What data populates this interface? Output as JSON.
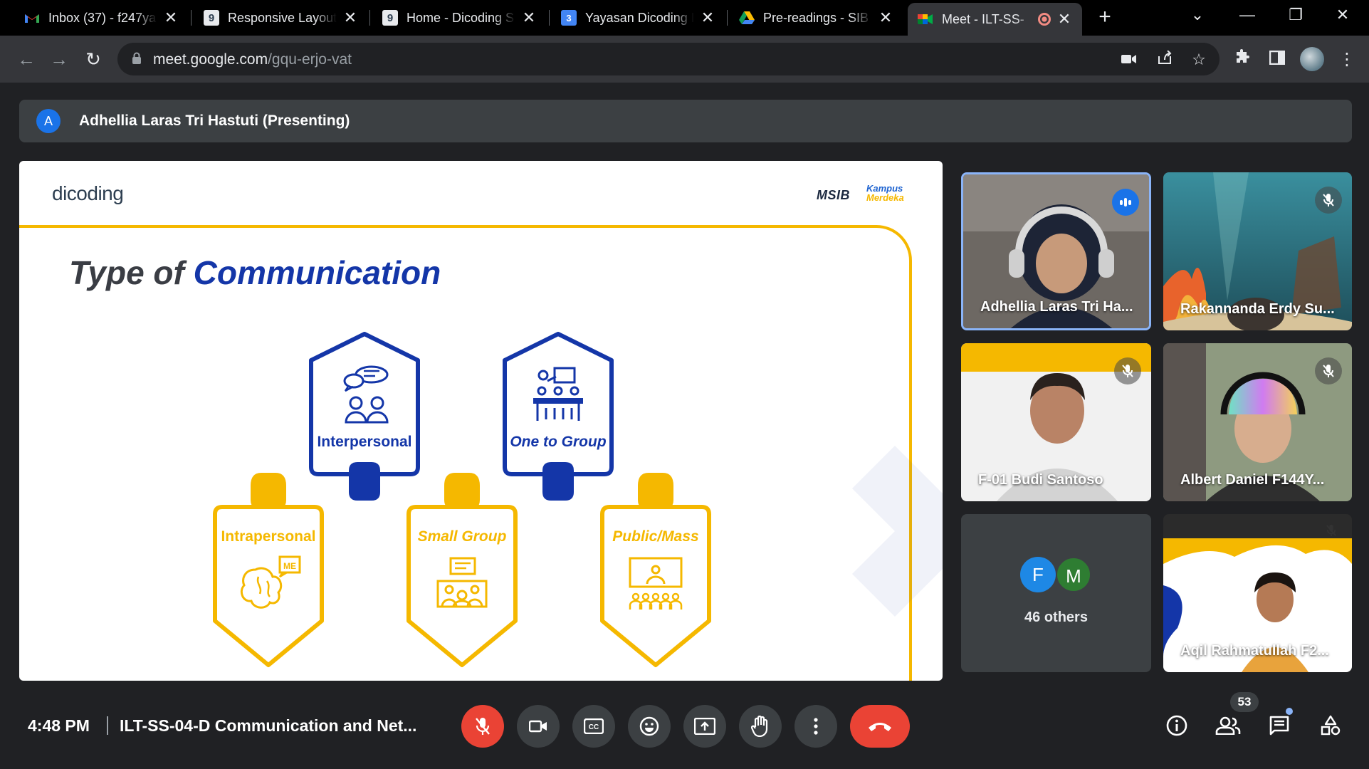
{
  "browser": {
    "tabs": [
      {
        "title": "Inbox (37) - f247ya",
        "icon": "gmail-icon"
      },
      {
        "title": "Responsive Layout",
        "icon": "dicoding-icon"
      },
      {
        "title": "Home - Dicoding S",
        "icon": "dicoding-icon"
      },
      {
        "title": "Yayasan Dicoding I",
        "icon": "calendar-icon"
      },
      {
        "title": "Pre-readings - SIB",
        "icon": "drive-icon"
      },
      {
        "title": "Meet - ILT-SS-",
        "icon": "meet-icon",
        "active": true
      }
    ],
    "calendar_day": "3",
    "url_host": "meet.google.com",
    "url_path": "/gqu-erjo-vat"
  },
  "presenting": {
    "avatar_letter": "A",
    "label": "Adhellia Laras Tri Hastuti (Presenting)"
  },
  "slide": {
    "logo": "dicoding",
    "brand_msib": "MSIB",
    "brand_kampus": "Kampus",
    "brand_merdeka": "Merdeka",
    "title_plain": "Type of ",
    "title_highlight": "Communication",
    "types": {
      "interpersonal": "Interpersonal",
      "one_to_group": "One to Group",
      "intrapersonal": "Intrapersonal",
      "small_group": "Small Group",
      "public_mass": "Public/Mass",
      "me_tag": "ME"
    },
    "colors": {
      "navy": "#1436a8",
      "yellow": "#f5b800"
    }
  },
  "participants": [
    {
      "name": "Adhellia Laras Tri Ha...",
      "state": "speaking"
    },
    {
      "name": "Rakannanda Erdy Su...",
      "state": "muted"
    },
    {
      "name": "F-01 Budi Santoso",
      "state": "muted"
    },
    {
      "name": "Albert Daniel F144Y...",
      "state": "muted"
    },
    {
      "name": "Aqil Rahmatullah F2...",
      "state": "muted"
    }
  ],
  "others": {
    "avatars": [
      {
        "letter": "F",
        "color": "#1e88e5"
      },
      {
        "letter": "M",
        "color": "#2e7d32"
      }
    ],
    "label": "46 others"
  },
  "bottom": {
    "time": "4:48 PM",
    "meeting_title": "ILT-SS-04-D Communication and Net...",
    "people_count": "53"
  }
}
